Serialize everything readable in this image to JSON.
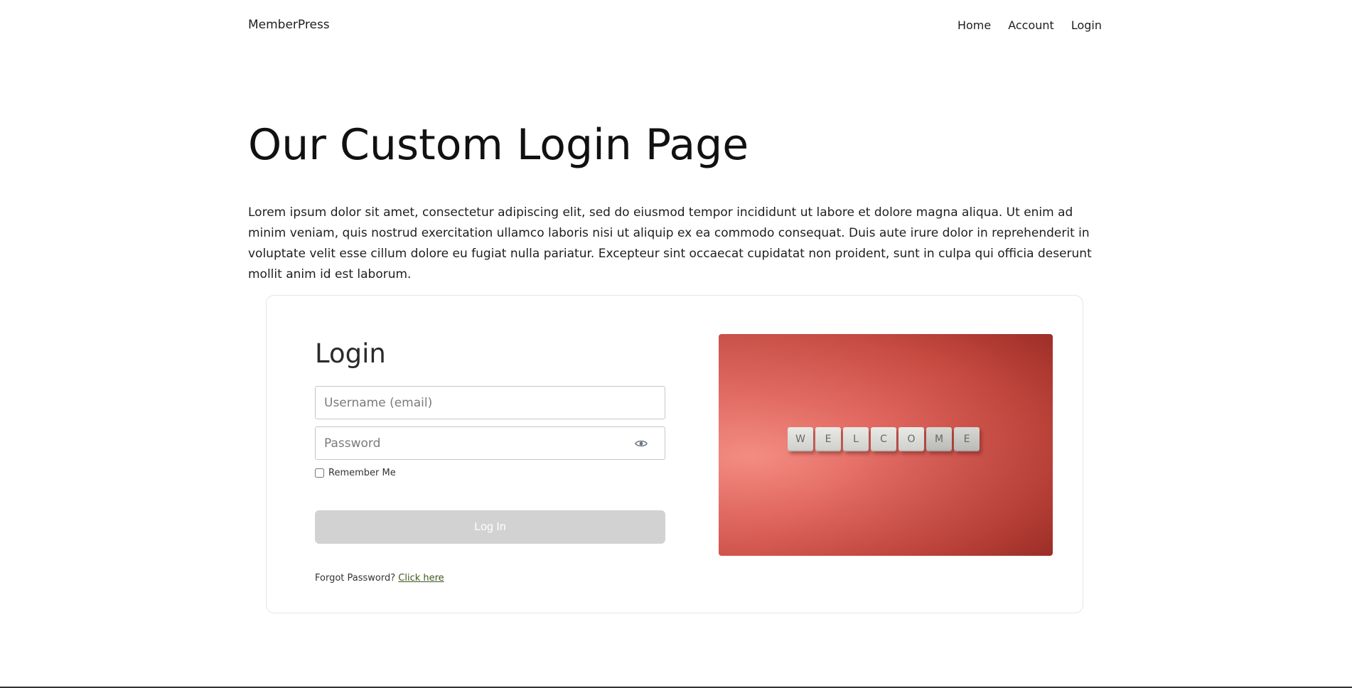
{
  "header": {
    "brand": "MemberPress",
    "nav": [
      {
        "label": "Home"
      },
      {
        "label": "Account"
      },
      {
        "label": "Login"
      }
    ]
  },
  "main": {
    "title": "Our Custom Login Page",
    "intro": "Lorem ipsum dolor sit amet, consectetur adipiscing elit, sed do eiusmod tempor incididunt ut labore et dolore magna aliqua. Ut enim ad minim veniam, quis nostrud exercitation ullamco laboris nisi ut aliquip ex ea commodo consequat. Duis aute irure dolor in reprehenderit in voluptate velit esse cillum dolore eu fugiat nulla pariatur. Excepteur sint occaecat cupidatat non proident, sunt in culpa qui officia deserunt mollit anim id est laborum."
  },
  "login": {
    "heading": "Login",
    "username": {
      "placeholder": "Username (email)",
      "value": ""
    },
    "password": {
      "placeholder": "Password",
      "value": "",
      "toggle_icon": "eye-icon"
    },
    "remember_label": "Remember Me",
    "remember_checked": false,
    "submit_label": "Log In",
    "forgot_text": "Forgot Password?",
    "forgot_link": "Click here"
  },
  "image": {
    "tiles": [
      "W",
      "E",
      "L",
      "C",
      "O",
      "M",
      "E"
    ]
  },
  "colors": {
    "button_disabled": "#d2d2d2",
    "link": "#3c5a1e",
    "image_bg": "#e0675f"
  }
}
